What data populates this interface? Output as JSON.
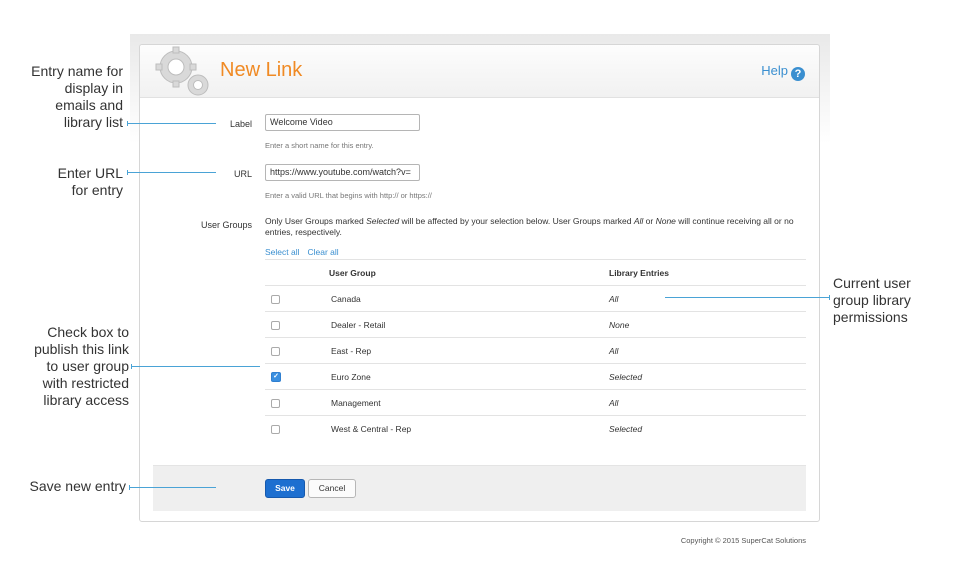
{
  "header": {
    "title": "New Link",
    "help_label": "Help",
    "help_icon": "?"
  },
  "form": {
    "label_field": {
      "label": "Label",
      "value": "Welcome Video",
      "hint": "Enter a short name for this entry."
    },
    "url_field": {
      "label": "URL",
      "value": "https://www.youtube.com/watch?v=",
      "hint": "Enter a valid URL that begins with http:// or https://"
    },
    "user_groups": {
      "label": "User Groups",
      "desc_part1": "Only User Groups marked ",
      "desc_em1": "Selected",
      "desc_part2": " will be affected by your selection below. User Groups marked ",
      "desc_em2": "All",
      "desc_part3": " or ",
      "desc_em3": "None",
      "desc_part4": " will continue receiving all or no entries, respectively.",
      "select_all": "Select all",
      "clear_all": "Clear all"
    }
  },
  "table": {
    "columns": [
      "User Group",
      "Library Entries"
    ],
    "rows": [
      {
        "group": "Canada",
        "entries": "All",
        "checked": false
      },
      {
        "group": "Dealer - Retail",
        "entries": "None",
        "checked": false
      },
      {
        "group": "East - Rep",
        "entries": "All",
        "checked": false
      },
      {
        "group": "Euro Zone",
        "entries": "Selected",
        "checked": true
      },
      {
        "group": "Management",
        "entries": "All",
        "checked": false
      },
      {
        "group": "West & Central - Rep",
        "entries": "Selected",
        "checked": false
      }
    ]
  },
  "footer": {
    "save_label": "Save",
    "cancel_label": "Cancel"
  },
  "copyright": "Copyright © 2015 SuperCat Solutions",
  "annotations": {
    "entry_name": [
      "Entry name for",
      "display in",
      "emails and",
      "library list"
    ],
    "enter_url": [
      "Enter URL",
      "for entry"
    ],
    "check_box": [
      "Check box to",
      "publish this link",
      "to user group",
      "with restricted",
      "library access"
    ],
    "save_entry": [
      "Save new entry"
    ],
    "current_perms": [
      "Current user",
      "group library",
      "permissions"
    ]
  },
  "colors": {
    "title": "#f08a24",
    "link": "#3a8fd0",
    "primary_button": "#1d6fd0",
    "annotation_line": "#4aa3d6"
  }
}
